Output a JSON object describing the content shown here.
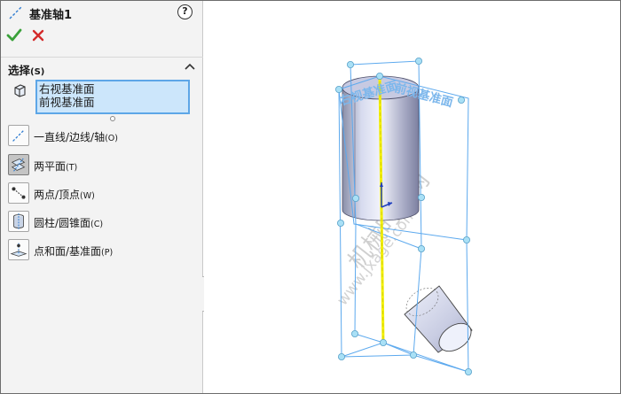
{
  "panel": {
    "title": "基准轴1",
    "help_label": "?",
    "ok_icon": "checkmark-icon",
    "cancel_icon": "close-icon",
    "section": {
      "title": "选择",
      "mnemonic": "(S)"
    },
    "selection_items": [
      "右视基准面",
      "前视基准面"
    ],
    "options": [
      {
        "label": "一直线/边线/轴",
        "mnemonic": "(O)",
        "icon": "line-edge-axis-icon",
        "active": false
      },
      {
        "label": "两平面",
        "mnemonic": "(T)",
        "icon": "two-planes-icon",
        "active": true
      },
      {
        "label": "两点/顶点",
        "mnemonic": "(W)",
        "icon": "two-points-icon",
        "active": false
      },
      {
        "label": "圆柱/圆锥面",
        "mnemonic": "(C)",
        "icon": "cylinder-cone-icon",
        "active": false
      },
      {
        "label": "点和面/基准面",
        "mnemonic": "(P)",
        "icon": "point-plane-icon",
        "active": false
      }
    ]
  },
  "viewport": {
    "plane_labels": [
      "右视基准面",
      "前视基准面"
    ],
    "watermark": [
      "机械时代网",
      "www.jxage.com"
    ],
    "colors": {
      "plane_edge": "#5ca9ee",
      "handle": "#8fd3ef",
      "axis": "#f3f000",
      "label": "#7cb7ec",
      "watermark": "#c9c9c9"
    }
  }
}
